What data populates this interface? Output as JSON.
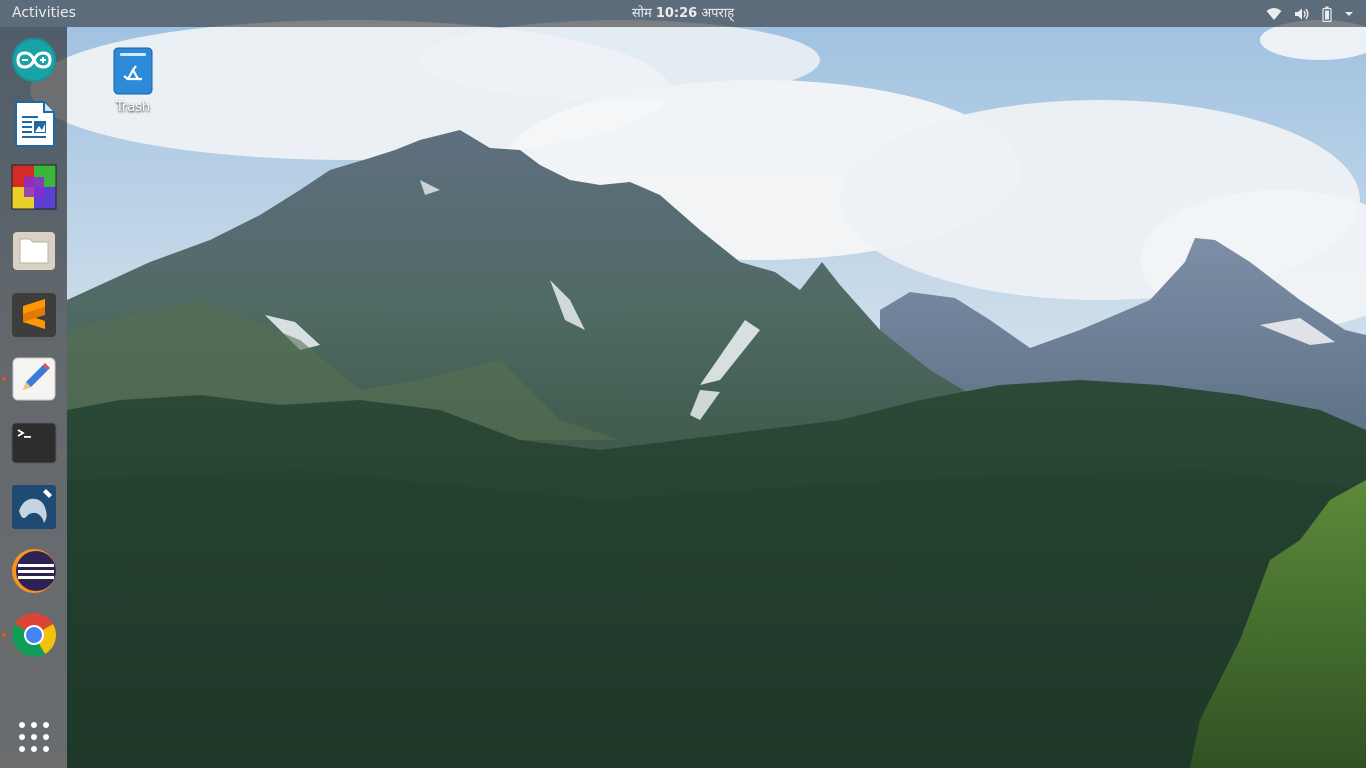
{
  "topbar": {
    "activities_label": "Activities",
    "clock_day": "सोम",
    "clock_time": "10:26",
    "clock_period": "अपराह्",
    "tray_icons": [
      "wifi-icon",
      "volume-icon",
      "battery-icon",
      "menu-arrow-icon"
    ]
  },
  "dock": {
    "apps": [
      {
        "name": "arduino",
        "running": false
      },
      {
        "name": "libreoffice-writer",
        "running": false
      },
      {
        "name": "rubiks-cube",
        "running": false
      },
      {
        "name": "files",
        "running": false
      },
      {
        "name": "sublime-text",
        "running": false
      },
      {
        "name": "text-editor",
        "running": true
      },
      {
        "name": "terminal",
        "running": false
      },
      {
        "name": "mysql-workbench",
        "running": false
      },
      {
        "name": "eclipse",
        "running": false
      },
      {
        "name": "chrome",
        "running": true
      }
    ],
    "show_apps_icon": "grid-icon"
  },
  "desktop": {
    "icons": [
      {
        "label": "Trash",
        "icon": "trash-icon"
      }
    ]
  },
  "colors": {
    "topbar_bg": "#262626",
    "dock_bg": "#1e1e1e",
    "running_indicator": "#e95420",
    "trash_blue": "#2d8ad8"
  }
}
